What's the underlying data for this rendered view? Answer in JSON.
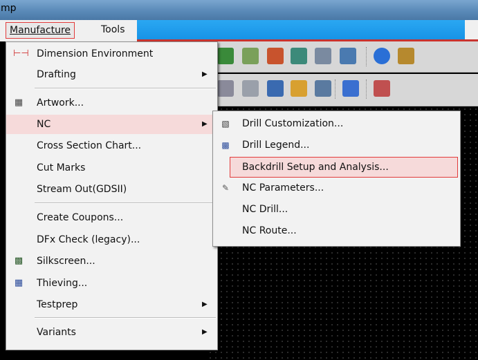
{
  "window": {
    "title_fragment": "mp"
  },
  "menubar": {
    "items": [
      {
        "label": "Manufacture",
        "selected": true
      },
      {
        "label": "Tools"
      }
    ]
  },
  "menu": {
    "items": [
      {
        "label": "Dimension Environment",
        "icon": "dimension-icon"
      },
      {
        "label": "Drafting",
        "submenu": true
      },
      {
        "label": "Artwork...",
        "icon": "artwork-icon"
      },
      {
        "label": "NC",
        "submenu": true,
        "highlighted": true
      },
      {
        "label": "Cross Section Chart..."
      },
      {
        "label": "Cut Marks"
      },
      {
        "label": "Stream Out(GDSII)"
      },
      {
        "label": "Create Coupons..."
      },
      {
        "label": "DFx Check (legacy)..."
      },
      {
        "label": "Silkscreen...",
        "icon": "silkscreen-icon"
      },
      {
        "label": "Thieving...",
        "icon": "thieving-icon"
      },
      {
        "label": "Testprep",
        "submenu": true
      },
      {
        "label": "Variants",
        "submenu": true
      }
    ]
  },
  "submenu": {
    "items": [
      {
        "label": "Drill Customization...",
        "icon": "drill-customization-icon"
      },
      {
        "label": "Drill Legend...",
        "icon": "drill-legend-icon"
      },
      {
        "label": "Backdrill Setup and Analysis...",
        "boxed": true
      },
      {
        "label": "NC Parameters...",
        "icon": "nc-parameters-icon"
      },
      {
        "label": "NC Drill..."
      },
      {
        "label": "NC Route..."
      }
    ]
  },
  "colors": {
    "highlight": "#f6dada",
    "annotation_red": "#e23a3a",
    "menubar_blue": "#1591e5"
  }
}
